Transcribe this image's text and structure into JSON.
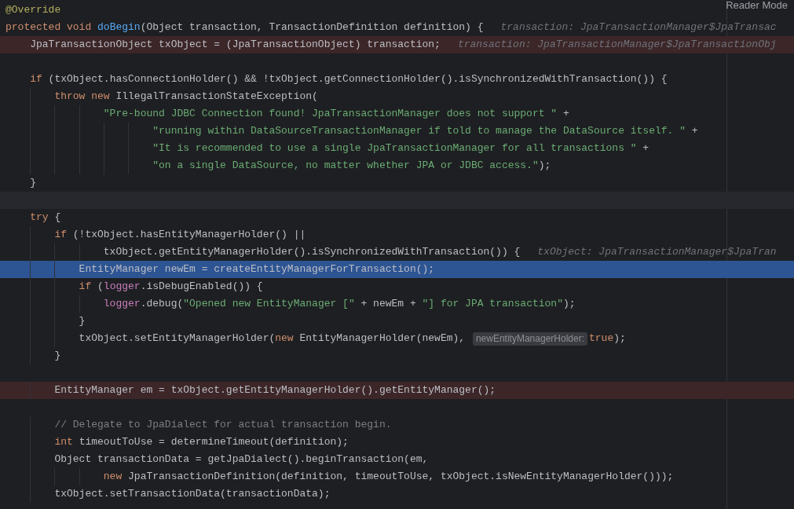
{
  "reader_mode": "Reader Mode",
  "lines": [
    {
      "kind": "code",
      "tokens": [
        {
          "kind": "annotation",
          "text": "@Override"
        }
      ]
    },
    {
      "kind": "code",
      "tokens": [
        {
          "kind": "keyword",
          "text": "protected void "
        },
        {
          "kind": "declaration",
          "text": "doBegin"
        },
        {
          "kind": "plain",
          "text": "(Object transaction, TransactionDefinition definition) {"
        },
        {
          "kind": "hint",
          "text": "transaction: JpaTransactionManager$JpaTransac"
        }
      ]
    },
    {
      "kind": "breakpoint",
      "tokens": [
        {
          "kind": "plain",
          "text": "    JpaTransactionObject txObject = (JpaTransactionObject) transaction;"
        },
        {
          "kind": "hint",
          "text": "transaction: JpaTransactionManager$JpaTransactionObj"
        }
      ]
    },
    {
      "kind": "blank"
    },
    {
      "kind": "code",
      "tokens": [
        {
          "kind": "keyword",
          "text": "    if"
        },
        {
          "kind": "plain",
          "text": " (txObject.hasConnectionHolder() && !txObject.getConnectionHolder().isSynchronizedWithTransaction()) {"
        }
      ]
    },
    {
      "kind": "code",
      "tokens": [
        {
          "kind": "keyword",
          "text": "        throw new"
        },
        {
          "kind": "plain",
          "text": " IllegalTransactionStateException("
        }
      ]
    },
    {
      "kind": "code",
      "tokens": [
        {
          "kind": "string",
          "text": "                \"Pre-bound JDBC Connection found! JpaTransactionManager does not support \""
        },
        {
          "kind": "plain",
          "text": " +"
        }
      ]
    },
    {
      "kind": "code",
      "tokens": [
        {
          "kind": "string",
          "text": "                        \"running within DataSourceTransactionManager if told to manage the DataSource itself. \""
        },
        {
          "kind": "plain",
          "text": " +"
        }
      ]
    },
    {
      "kind": "code",
      "tokens": [
        {
          "kind": "string",
          "text": "                        \"It is recommended to use a single JpaTransactionManager for all transactions \""
        },
        {
          "kind": "plain",
          "text": " +"
        }
      ]
    },
    {
      "kind": "code",
      "tokens": [
        {
          "kind": "string",
          "text": "                        \"on a single DataSource, no matter whether JPA or JDBC access.\""
        },
        {
          "kind": "plain",
          "text": ");"
        }
      ]
    },
    {
      "kind": "code",
      "tokens": [
        {
          "kind": "plain",
          "text": "    }"
        }
      ]
    },
    {
      "kind": "current"
    },
    {
      "kind": "code",
      "tokens": [
        {
          "kind": "keyword",
          "text": "    try"
        },
        {
          "kind": "plain",
          "text": " {"
        }
      ]
    },
    {
      "kind": "code",
      "tokens": [
        {
          "kind": "keyword",
          "text": "        if"
        },
        {
          "kind": "plain",
          "text": " (!txObject.hasEntityManagerHolder() ||"
        }
      ]
    },
    {
      "kind": "code",
      "tokens": [
        {
          "kind": "plain",
          "text": "                txObject.getEntityManagerHolder().isSynchronizedWithTransaction()) {"
        },
        {
          "kind": "hint",
          "text": "txObject: JpaTransactionManager$JpaTran"
        }
      ]
    },
    {
      "kind": "execution",
      "tokens": [
        {
          "kind": "plain",
          "text": "            EntityManager newEm = createEntityManagerForTransaction();"
        }
      ]
    },
    {
      "kind": "code",
      "tokens": [
        {
          "kind": "keyword",
          "text": "            if"
        },
        {
          "kind": "plain",
          "text": " ("
        },
        {
          "kind": "field",
          "text": "logger"
        },
        {
          "kind": "plain",
          "text": ".isDebugEnabled()) {"
        }
      ]
    },
    {
      "kind": "code",
      "tokens": [
        {
          "kind": "field",
          "text": "                logger"
        },
        {
          "kind": "plain",
          "text": ".debug("
        },
        {
          "kind": "string",
          "text": "\"Opened new EntityManager [\""
        },
        {
          "kind": "plain",
          "text": " + newEm + "
        },
        {
          "kind": "string",
          "text": "\"] for JPA transaction\""
        },
        {
          "kind": "plain",
          "text": ");"
        }
      ]
    },
    {
      "kind": "code",
      "tokens": [
        {
          "kind": "plain",
          "text": "            }"
        }
      ]
    },
    {
      "kind": "code",
      "tokens": [
        {
          "kind": "plain",
          "text": "            txObject.setEntityManagerHolder("
        },
        {
          "kind": "keyword",
          "text": "new"
        },
        {
          "kind": "plain",
          "text": " EntityManagerHolder(newEm), "
        },
        {
          "kind": "param-hint",
          "text": "newEntityManagerHolder:"
        },
        {
          "kind": "keyword",
          "text": "true"
        },
        {
          "kind": "plain",
          "text": ");"
        }
      ]
    },
    {
      "kind": "code",
      "tokens": [
        {
          "kind": "plain",
          "text": "        }"
        }
      ]
    },
    {
      "kind": "blank"
    },
    {
      "kind": "breakpoint",
      "tokens": [
        {
          "kind": "plain",
          "text": "        EntityManager em = txObject.getEntityManagerHolder().getEntityManager();"
        }
      ]
    },
    {
      "kind": "blank"
    },
    {
      "kind": "code",
      "tokens": [
        {
          "kind": "comment",
          "text": "        // Delegate to JpaDialect for actual transaction begin."
        }
      ]
    },
    {
      "kind": "code",
      "tokens": [
        {
          "kind": "keyword",
          "text": "        int"
        },
        {
          "kind": "plain",
          "text": " timeoutToUse = determineTimeout(definition);"
        }
      ]
    },
    {
      "kind": "code",
      "tokens": [
        {
          "kind": "plain",
          "text": "        Object transactionData = getJpaDialect().beginTransaction(em,"
        }
      ]
    },
    {
      "kind": "code",
      "tokens": [
        {
          "kind": "keyword",
          "text": "                new"
        },
        {
          "kind": "plain",
          "text": " JpaTransactionDefinition(definition, timeoutToUse, txObject.isNewEntityManagerHolder()));"
        }
      ]
    },
    {
      "kind": "code",
      "tokens": [
        {
          "kind": "plain",
          "text": "        txObject.setTransactionData(transactionData);"
        }
      ]
    }
  ]
}
